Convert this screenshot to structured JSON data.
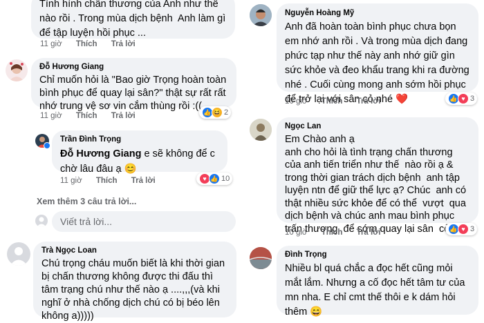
{
  "comments_left": [
    {
      "text": "Tình hình chân thương của Anh như thế nào rồi . Trong mùa dịch bệnh  Anh làm gì để tập luyện hồi phục ...",
      "time": "11 giờ",
      "like": "Thích",
      "reply": "Trả lời"
    },
    {
      "author": "Đỗ Hương Giang",
      "text": "Chỉ muốn hỏi là \"Bao giờ Trọng hoàn toàn bình phục để quay lại sân?\" thật sự rất rất nhớ trung vệ sơ vin cắm thùng rồi :((",
      "time": "11 giờ",
      "like": "Thích",
      "reply": "Trả lời",
      "reaction_count": "2"
    },
    {
      "author": "Trần Đình Trọng",
      "mention": "Đỗ Hương Giang",
      "text": " e sẽ không để c chờ lâu đâu ạ 😊",
      "time": "11 giờ",
      "like": "Thích",
      "reply": "Trả lời",
      "reaction_count": "10"
    }
  ],
  "more_replies": "Xem thêm 3 câu trả lời...",
  "reply_placeholder": "Viết trả lời...",
  "comment_loan": {
    "author": "Trà Ngọc Loan",
    "text": "Chú trọng cháu muốn biết là khi thời gian bị chấn thương không được thi đấu thì tâm trạng chú như thế nào ạ ....,,,(và khi nghĩ ở nhà chống dịch chú có bị béo lên không a)))))"
  },
  "comments_right": [
    {
      "author": "Nguyễn Hoàng Mỹ",
      "text": "Anh đã hoàn toàn bình phục chưa bọn em nhớ anh rồi . Và trong mùa dịch đang phức tạp như thế này anh nhớ giữ gìn sức khỏe và đeo khẩu trang khi ra đường nhé . Cuối cùng mong anh sớm hồi phục để trở lại với sân cỏ nhé ❤️",
      "time": "10 giờ",
      "like": "Thích",
      "reply": "Trả lời",
      "reaction_count": "3"
    },
    {
      "author": "Ngọc Lan",
      "text": "Em Chào anh ạ\nanh cho hỏi là tình trạng chấn thương  của anh tiến triển như thế  nào rồi ạ & trong thời gian trách dịch bệnh  anh tập luyện ntn để giữ thể lực ạ? Chúc  anh có thật nhiều sức khỏe để có thể  vượt  qua dịch bệnh và chúc anh mau bình phục trấn thương  để sớm quay lại sân  cỏ ạ!",
      "time": "10 giờ",
      "like": "Thích",
      "reply": "Trả lời",
      "reaction_count": "3"
    },
    {
      "author": "Đình Trọng",
      "text": "Nhiều bl quá chắc a đọc hết cũng mỏi mắt lắm. Nhưng a cố đọc hết tâm tư của mn nha. E chỉ cmt thế thôi e k dám hỏi thêm 😄"
    }
  ],
  "colors": {
    "bubble": "#f0f2f5",
    "meta": "#65676b",
    "like": "#1877f2",
    "love": "#f33e58",
    "haha": "#f7b125"
  }
}
